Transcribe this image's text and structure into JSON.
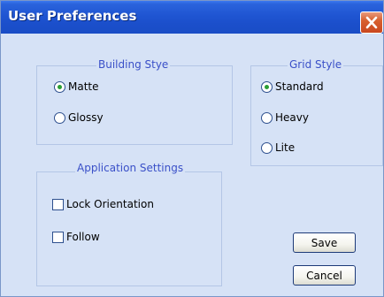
{
  "window": {
    "title": "User Preferences",
    "close_icon": "close-icon"
  },
  "building_style": {
    "title": "Building Stye",
    "options": [
      {
        "label": "Matte",
        "checked": true
      },
      {
        "label": "Glossy",
        "checked": false
      }
    ]
  },
  "grid_style": {
    "title": "Grid Style",
    "options": [
      {
        "label": "Standard",
        "checked": true
      },
      {
        "label": "Heavy",
        "checked": false
      },
      {
        "label": "Lite",
        "checked": false
      }
    ]
  },
  "application_settings": {
    "title": "Application Settings",
    "options": [
      {
        "label": "Lock Orientation",
        "checked": false
      },
      {
        "label": "Follow",
        "checked": false
      }
    ]
  },
  "buttons": {
    "save": "Save",
    "cancel": "Cancel"
  },
  "colors": {
    "titlebar": "#1f55d2",
    "body": "#d6e2f6",
    "group_title": "#3a50c8",
    "close_button": "#d8602f",
    "radio_dot": "#2a9e34"
  }
}
